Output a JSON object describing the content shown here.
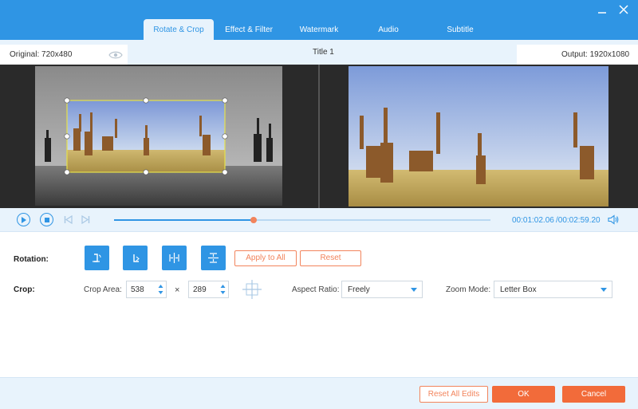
{
  "tabs": [
    "Rotate & Crop",
    "Effect & Filter",
    "Watermark",
    "Audio",
    "Subtitle"
  ],
  "info": {
    "original": "Original: 720x480",
    "title": "Title 1",
    "output": "Output: 1920x1080"
  },
  "player": {
    "current_time": "00:01:02.06",
    "total_time": "/00:02:59.20",
    "progress": 0.37
  },
  "rotation": {
    "label": "Rotation:",
    "apply_all": "Apply to All",
    "reset": "Reset"
  },
  "crop": {
    "label": "Crop:",
    "area_label": "Crop Area:",
    "width": "538",
    "times": "×",
    "height": "289",
    "aspect_label": "Aspect Ratio:",
    "aspect_value": "Freely",
    "zoom_label": "Zoom Mode:",
    "zoom_value": "Letter Box"
  },
  "footer": {
    "reset_all": "Reset All Edits",
    "ok": "OK",
    "cancel": "Cancel"
  },
  "colors": {
    "accent": "#2f95e4",
    "orange": "#f2845c",
    "ok_bg": "#f26b3a"
  },
  "icons": [
    "minimize-icon",
    "close-icon",
    "eye-icon",
    "play-icon",
    "stop-icon",
    "prev-frame-icon",
    "next-frame-icon",
    "volume-icon",
    "rotate-left-icon",
    "rotate-right-icon",
    "flip-horizontal-icon",
    "flip-vertical-icon",
    "center-crop-icon",
    "chevron-down-icon"
  ]
}
